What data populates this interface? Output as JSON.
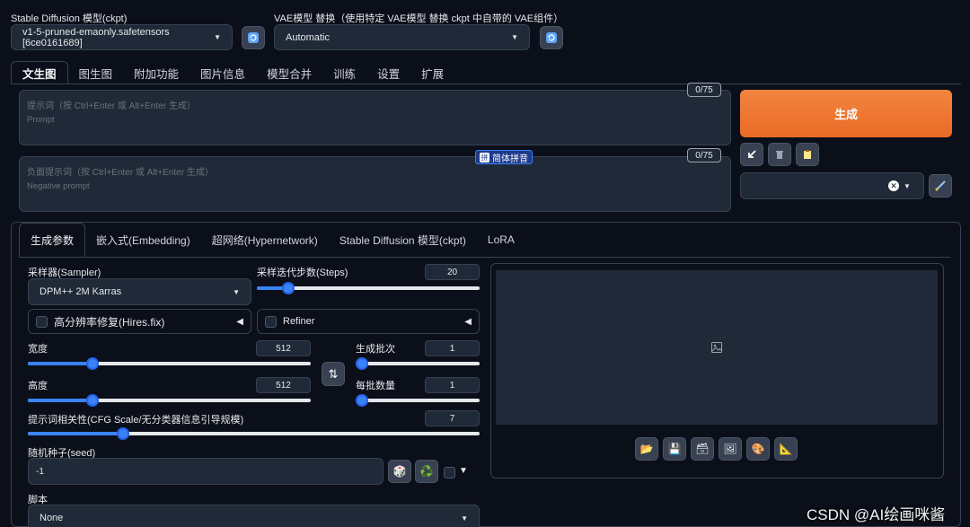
{
  "top": {
    "ckpt_label": "Stable Diffusion 模型(ckpt)",
    "ckpt_value": "v1-5-pruned-emaonly.safetensors [6ce0161689]",
    "vae_label": "VAE模型 替换（使用特定 VAE模型 替换 ckpt 中自带的 VAE组件）",
    "vae_value": "Automatic"
  },
  "tabs": [
    "文生图",
    "图生图",
    "附加功能",
    "图片信息",
    "模型合并",
    "训练",
    "设置",
    "扩展"
  ],
  "prompt": {
    "placeholder_cn": "提示词（按 Ctrl+Enter 或 Alt+Enter 生成）",
    "placeholder_en": "Prompt",
    "counter": "0/75"
  },
  "negative_prompt": {
    "placeholder_cn": "负面提示词（按 Ctrl+Enter 或 Alt+Enter 生成）",
    "placeholder_en": "Negative prompt",
    "counter": "0/75"
  },
  "ime_badge": "简体拼音",
  "generate_label": "生成",
  "subtabs": [
    "生成参数",
    "嵌入式(Embedding)",
    "超网络(Hypernetwork)",
    "Stable Diffusion 模型(ckpt)",
    "LoRA"
  ],
  "sampler": {
    "label": "采样器(Sampler)",
    "value": "DPM++ 2M Karras"
  },
  "steps": {
    "label": "采样迭代步数(Steps)",
    "value": "20",
    "fraction": 0.14
  },
  "hires": {
    "label": "高分辨率修复(Hires.fix)"
  },
  "refiner": {
    "label": "Refiner"
  },
  "width": {
    "label": "宽度",
    "value": "512",
    "fraction": 0.23
  },
  "height": {
    "label": "高度",
    "value": "512",
    "fraction": 0.23
  },
  "batch_count": {
    "label": "生成批次",
    "value": "1",
    "fraction": 0.0
  },
  "batch_size": {
    "label": "每批数量",
    "value": "1",
    "fraction": 0.0
  },
  "cfg": {
    "label": "提示词相关性(CFG Scale/无分类器信息引导规模)",
    "value": "7",
    "fraction": 0.21
  },
  "seed": {
    "label": "随机种子(seed)",
    "value": "-1"
  },
  "script": {
    "label": "脚本",
    "value": "None"
  },
  "watermark": "CSDN @AI绘画咪酱",
  "colors": {
    "accent": "#3b82f6",
    "generate": "#f07a34",
    "background": "#0b0f19"
  }
}
